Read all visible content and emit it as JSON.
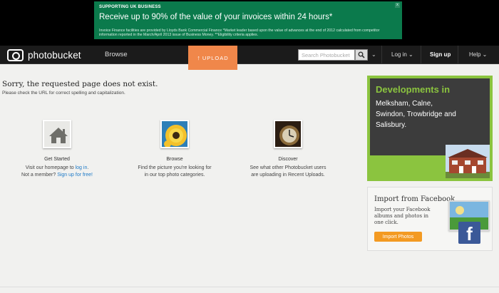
{
  "top_ad": {
    "tag": "SUPPORTING UK BUSINESS",
    "headline": "Receive up to 90% of the value of your invoices within 24 hours*",
    "fine_print": "Invoice Finance facilities are provided by Lloyds Bank Commercial Finance *Market leader based upon the value of advances at the end of 2012 calculated from competitor information reported in the March/April 2013 issue of Business Money. **Eligibility criteria applies.",
    "close": "x",
    "background": "#0b7a4c"
  },
  "navbar": {
    "logo_text": "photobucket",
    "browse": "Browse",
    "upload": "UPLOAD",
    "search_placeholder": "Search Photobucket",
    "login": "Log in",
    "signup": "Sign up",
    "help": "Help",
    "upload_color": "#f0874a"
  },
  "error": {
    "title": "Sorry, the requested page does not exist.",
    "subtitle": "Please check the URL for correct spelling and capitalization."
  },
  "features": [
    {
      "title": "Get Started",
      "line1_prefix": "Visit our homepage to ",
      "line1_link": "log in",
      "line1_suffix": ".",
      "line2_prefix": "Not a member? ",
      "line2_link": "Sign up for free!",
      "icon": "home-icon"
    },
    {
      "title": "Browse",
      "line1": "Find the picture you're looking for",
      "line2": "in our top photo categories.",
      "icon": "flower-photo"
    },
    {
      "title": "Discover",
      "line1": "See what other Photobucket users",
      "line2": "are uploading in Recent Uploads.",
      "icon": "clock-photo"
    }
  ],
  "dev_ad": {
    "headline": "Developments in",
    "body": "Melksham, Calne, Swindon, Trowbridge and Salisbury.",
    "accent": "#8bc43f"
  },
  "fb_ad": {
    "title": "Import from Facebook",
    "text": "Import your Facebook albums and photos in one click.",
    "button": "Import Photos",
    "logo": "f"
  }
}
